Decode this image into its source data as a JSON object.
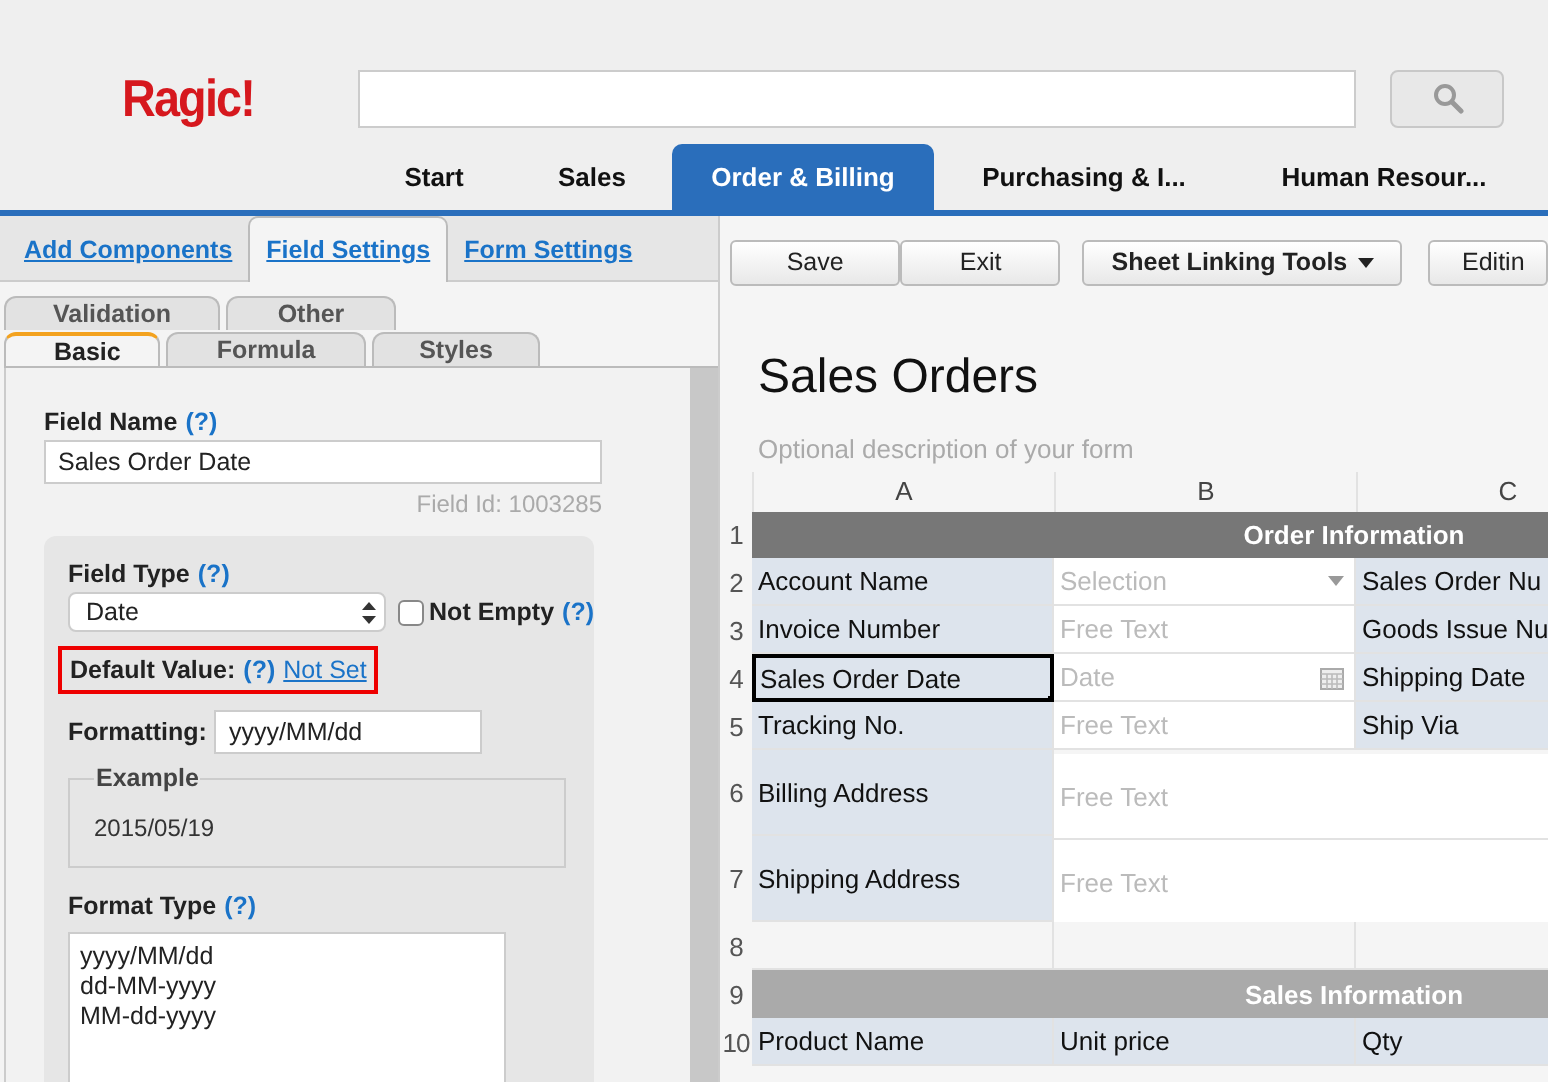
{
  "header": {
    "logo": "Ragic!",
    "nav_tabs": [
      {
        "label": "Start",
        "selected": false
      },
      {
        "label": "Sales",
        "selected": false
      },
      {
        "label": "Order & Billing",
        "selected": true
      },
      {
        "label": "Purchasing & I...",
        "selected": false
      },
      {
        "label": "Human Resour...",
        "selected": false
      }
    ]
  },
  "left_panel": {
    "tabs": [
      {
        "label": "Add Components",
        "selected": false
      },
      {
        "label": "Field Settings",
        "selected": true
      },
      {
        "label": "Form Settings",
        "selected": false
      }
    ],
    "subtab_rows": [
      [
        {
          "label": "Validation",
          "selected": false
        },
        {
          "label": "Other",
          "selected": false
        }
      ],
      [
        {
          "label": "Basic",
          "selected": true
        },
        {
          "label": "Formula",
          "selected": false
        },
        {
          "label": "Styles",
          "selected": false
        }
      ]
    ],
    "field_name": {
      "label": "Field Name",
      "help": "(?)",
      "value": "Sales Order Date"
    },
    "field_id": "Field Id: 1003285",
    "field_type": {
      "label": "Field Type",
      "help": "(?)",
      "value": "Date"
    },
    "not_empty": {
      "label": "Not Empty",
      "help": "(?)",
      "checked": false
    },
    "default_value": {
      "label": "Default Value:",
      "help": "(?)",
      "link": "Not Set",
      "highlighted": true
    },
    "formatting": {
      "label": "Formatting:",
      "value": "yyyy/MM/dd"
    },
    "example": {
      "legend": "Example",
      "value": "2015/05/19"
    },
    "format_type": {
      "label": "Format Type",
      "help": "(?)",
      "options": [
        "yyyy/MM/dd",
        "dd-MM-yyyy",
        "MM-dd-yyyy"
      ]
    }
  },
  "toolbar": {
    "buttons": [
      {
        "label": "Save",
        "kind": "plain"
      },
      {
        "label": "Exit",
        "kind": "plain"
      },
      {
        "label": "Sheet Linking Tools",
        "kind": "menu"
      },
      {
        "label": "Editin",
        "kind": "plain"
      }
    ]
  },
  "sheet": {
    "title": "Sales Orders",
    "description": "Optional description of your form",
    "columns": [
      "A",
      "B",
      "C"
    ],
    "rows": [
      {
        "num": "1",
        "kind": "section",
        "title": "Order Information",
        "color": "#777777"
      },
      {
        "num": "2",
        "kind": "fields",
        "cells": [
          {
            "kind": "label",
            "text": "Account Name",
            "selected": false
          },
          {
            "kind": "dropdown_input",
            "placeholder": "Selection"
          },
          {
            "kind": "label",
            "text": "Sales Order Nu",
            "selected": false
          }
        ]
      },
      {
        "num": "3",
        "kind": "fields",
        "cells": [
          {
            "kind": "label",
            "text": "Invoice Number",
            "selected": false
          },
          {
            "kind": "input",
            "placeholder": "Free Text"
          },
          {
            "kind": "label",
            "text": "Goods Issue Nu",
            "selected": false
          }
        ]
      },
      {
        "num": "4",
        "kind": "fields",
        "cells": [
          {
            "kind": "label",
            "text": "Sales Order Date",
            "selected": true
          },
          {
            "kind": "date_input",
            "placeholder": "Date"
          },
          {
            "kind": "label",
            "text": "Shipping Date",
            "selected": false
          }
        ]
      },
      {
        "num": "5",
        "kind": "fields",
        "cells": [
          {
            "kind": "label",
            "text": "Tracking No.",
            "selected": false
          },
          {
            "kind": "input",
            "placeholder": "Free Text"
          },
          {
            "kind": "label",
            "text": "Ship Via",
            "selected": false
          }
        ]
      },
      {
        "num": "6",
        "kind": "tall",
        "cells": [
          {
            "kind": "label",
            "text": "Billing Address",
            "selected": false
          },
          {
            "kind": "wide_input",
            "placeholder": "Free Text"
          }
        ]
      },
      {
        "num": "7",
        "kind": "tall",
        "cells": [
          {
            "kind": "label",
            "text": "Shipping Address",
            "selected": false
          },
          {
            "kind": "wide_input",
            "placeholder": "Free Text"
          }
        ]
      },
      {
        "num": "8",
        "kind": "fields",
        "cells": [
          {
            "kind": "empty"
          },
          {
            "kind": "empty"
          },
          {
            "kind": "empty"
          }
        ]
      },
      {
        "num": "9",
        "kind": "section",
        "title": "Sales Information",
        "color": "#aaaaaa"
      },
      {
        "num": "10",
        "kind": "fields",
        "cells": [
          {
            "kind": "label",
            "text": "Product Name",
            "selected": false
          },
          {
            "kind": "label",
            "text": "Unit price",
            "selected": false
          },
          {
            "kind": "label",
            "text": "Qty",
            "selected": false
          }
        ]
      }
    ]
  }
}
